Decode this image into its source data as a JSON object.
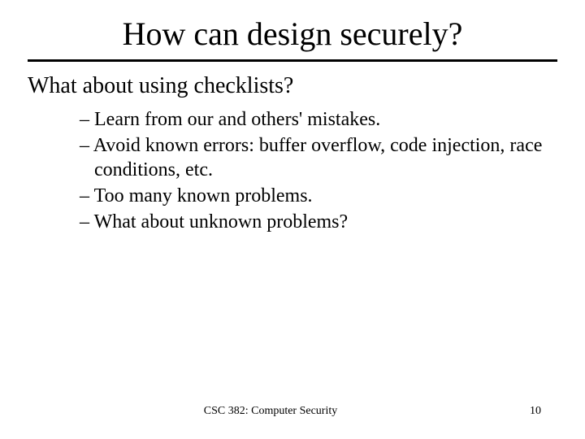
{
  "title": "How can design securely?",
  "subheading": "What about using checklists?",
  "bullets": [
    "Learn from our and others' mistakes.",
    "Avoid known errors: buffer overflow, code injection, race conditions, etc.",
    "Too many known problems.",
    "What about unknown problems?"
  ],
  "footer": {
    "course": "CSC 382: Computer Security",
    "page": "10"
  }
}
